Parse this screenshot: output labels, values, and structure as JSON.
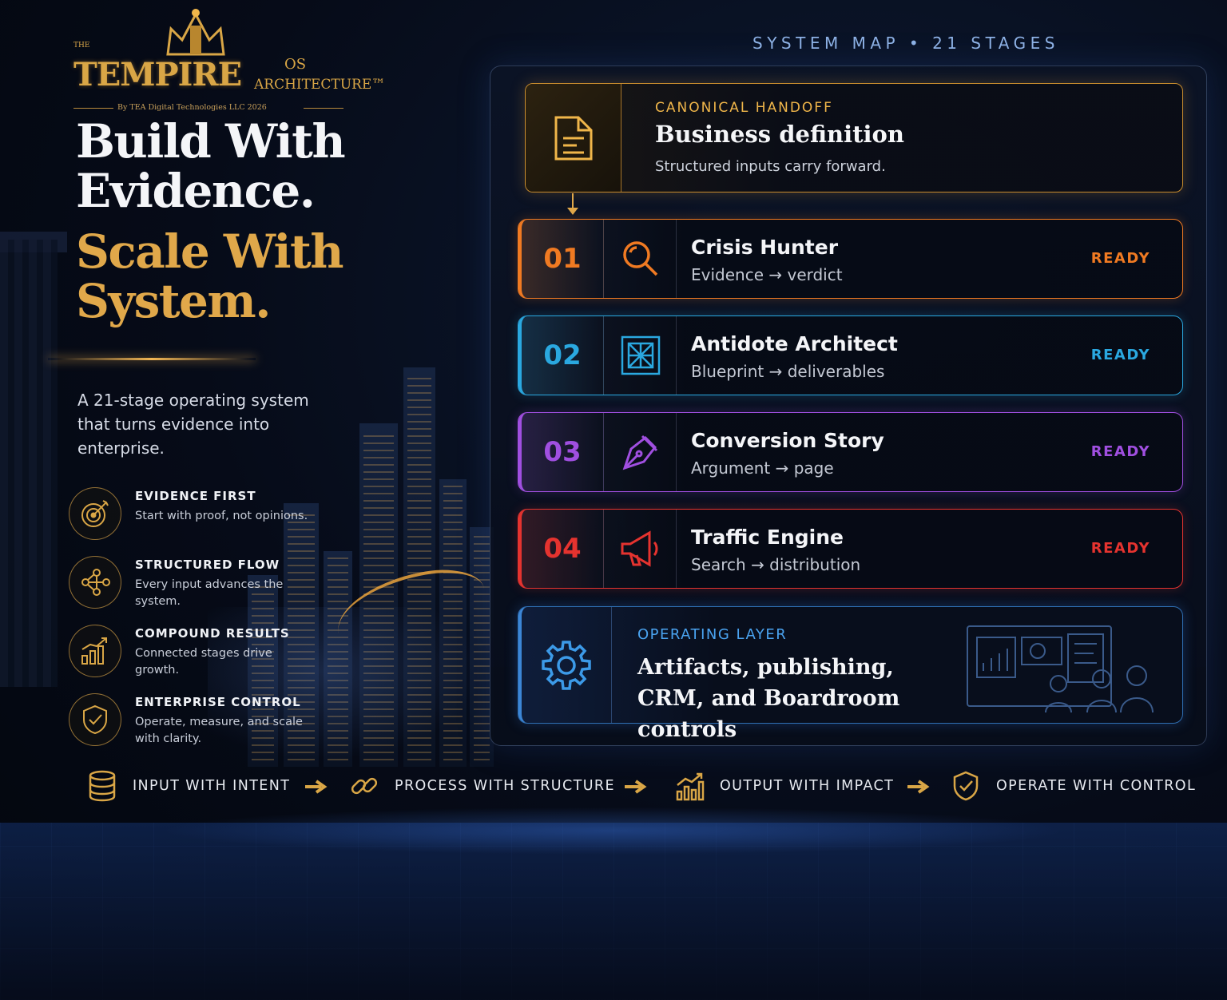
{
  "brand": {
    "the": "THE",
    "logo_main": "TEMPIRE",
    "logo_os": "OS",
    "logo_arch": "ARCHITECTURE™",
    "byline": "By TEA Digital Technologies LLC 2026",
    "gold": "#d9a646"
  },
  "hero": {
    "line1": "Build With",
    "line2": "Evidence.",
    "line3": "Scale With",
    "line4": "System.",
    "intro": "A 21-stage operating system that turns evidence into enterprise."
  },
  "features": [
    {
      "icon": "target-icon",
      "title": "EVIDENCE FIRST",
      "desc": "Start with proof, not opinions."
    },
    {
      "icon": "flow-nodes-icon",
      "title": "STRUCTURED FLOW",
      "desc": "Every input advances the system."
    },
    {
      "icon": "bar-chart-icon",
      "title": "COMPOUND RESULTS",
      "desc": "Connected stages drive growth."
    },
    {
      "icon": "shield-check-icon",
      "title": "ENTERPRISE CONTROL",
      "desc": "Operate, measure, and scale with clarity."
    }
  ],
  "map": {
    "title": "SYSTEM MAP • 21 STAGES",
    "handoff": {
      "icon": "document-icon",
      "label": "CANONICAL HANDOFF",
      "title": "Business definition",
      "desc": "Structured inputs carry forward."
    },
    "stages": [
      {
        "num": "01",
        "icon": "search-icon",
        "title": "Crisis Hunter",
        "sub": "Evidence → verdict",
        "status": "READY",
        "color": "#f07a22"
      },
      {
        "num": "02",
        "icon": "blueprint-icon",
        "title": "Antidote Architect",
        "sub": "Blueprint → deliverables",
        "status": "READY",
        "color": "#2aa8e0"
      },
      {
        "num": "03",
        "icon": "pen-nib-icon",
        "title": "Conversion Story",
        "sub": "Argument → page",
        "status": "READY",
        "color": "#a04fe0"
      },
      {
        "num": "04",
        "icon": "megaphone-icon",
        "title": "Traffic Engine",
        "sub": "Search → distribution",
        "status": "READY",
        "color": "#e5332f"
      }
    ],
    "operating": {
      "icon": "gear-icon",
      "label": "OPERATING LAYER",
      "title": "Artifacts, publishing, CRM, and Boardroom controls"
    }
  },
  "flow": [
    {
      "icon": "database-icon",
      "label": "INPUT WITH INTENT"
    },
    {
      "icon": "link-icon",
      "label": "PROCESS WITH STRUCTURE"
    },
    {
      "icon": "growth-chart-icon",
      "label": "OUTPUT WITH IMPACT"
    },
    {
      "icon": "shield-check-icon",
      "label": "OPERATE WITH CONTROL"
    }
  ]
}
